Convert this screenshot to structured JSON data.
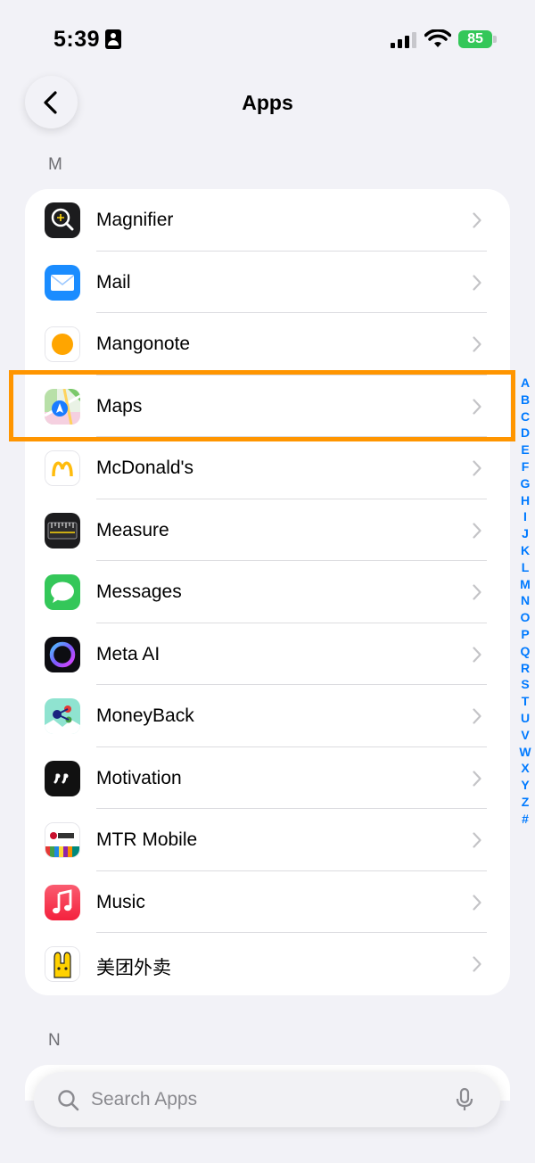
{
  "status_bar": {
    "time": "5:39",
    "battery": "85"
  },
  "header": {
    "title": "Apps"
  },
  "sections": [
    {
      "letter": "M",
      "items": [
        {
          "label": "Magnifier"
        },
        {
          "label": "Mail"
        },
        {
          "label": "Mangonote"
        },
        {
          "label": "Maps"
        },
        {
          "label": "McDonald's"
        },
        {
          "label": "Measure"
        },
        {
          "label": "Messages"
        },
        {
          "label": "Meta AI"
        },
        {
          "label": "MoneyBack"
        },
        {
          "label": "Motivation"
        },
        {
          "label": "MTR Mobile"
        },
        {
          "label": "Music"
        },
        {
          "label": "美团外卖"
        }
      ]
    },
    {
      "letter": "N"
    }
  ],
  "index_letters": [
    "A",
    "B",
    "C",
    "D",
    "E",
    "F",
    "G",
    "H",
    "I",
    "J",
    "K",
    "L",
    "M",
    "N",
    "O",
    "P",
    "Q",
    "R",
    "S",
    "T",
    "U",
    "V",
    "W",
    "X",
    "Y",
    "Z",
    "#"
  ],
  "search": {
    "placeholder": "Search Apps"
  },
  "colors": {
    "highlight": "#ff9500",
    "index": "#007aff",
    "battery": "#34c759"
  },
  "icons": {
    "back": "chevron-left-icon",
    "row_chevron": "chevron-right-icon",
    "search": "magnifying-glass-icon",
    "mic": "microphone-icon"
  }
}
